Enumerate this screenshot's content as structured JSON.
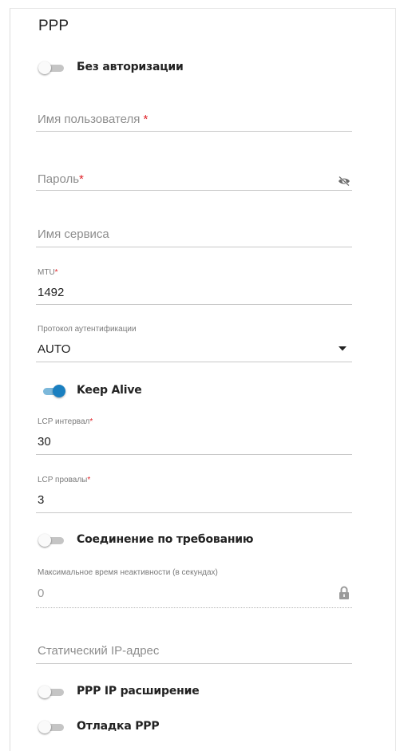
{
  "section": {
    "title": "PPP"
  },
  "toggles": {
    "no_auth": {
      "label": "Без авторизации",
      "on": false
    },
    "keep_alive": {
      "label": "Keep Alive",
      "on": true
    },
    "on_demand": {
      "label": "Соединение по требованию",
      "on": false
    },
    "ppp_ip_ext": {
      "label": "PPP IP расширение",
      "on": false
    },
    "ppp_debug": {
      "label": "Отладка PPP",
      "on": false
    }
  },
  "fields": {
    "username": {
      "placeholder": "Имя пользователя",
      "required_mark": "*",
      "value": ""
    },
    "password": {
      "placeholder": "Пароль",
      "required_mark": "*",
      "value": "",
      "icon": "eye-off-icon"
    },
    "service_name": {
      "placeholder": "Имя сервиса",
      "value": ""
    },
    "mtu": {
      "label": "MTU",
      "required_mark": "*",
      "value": "1492"
    },
    "auth_protocol": {
      "label": "Протокол аутентификации",
      "value": "AUTO",
      "icon": "dropdown-arrow-icon"
    },
    "lcp_interval": {
      "label": "LCP интервал",
      "required_mark": "*",
      "value": "30"
    },
    "lcp_failures": {
      "label": "LCP провалы",
      "required_mark": "*",
      "value": "3"
    },
    "max_idle": {
      "label": "Максимальное время неактивности (в секундах)",
      "value": "0",
      "icon": "lock-icon"
    },
    "static_ip": {
      "placeholder": "Статический IP-адрес",
      "value": ""
    }
  },
  "colors": {
    "accent": "#1a7fc0",
    "required": "#e0242a"
  }
}
